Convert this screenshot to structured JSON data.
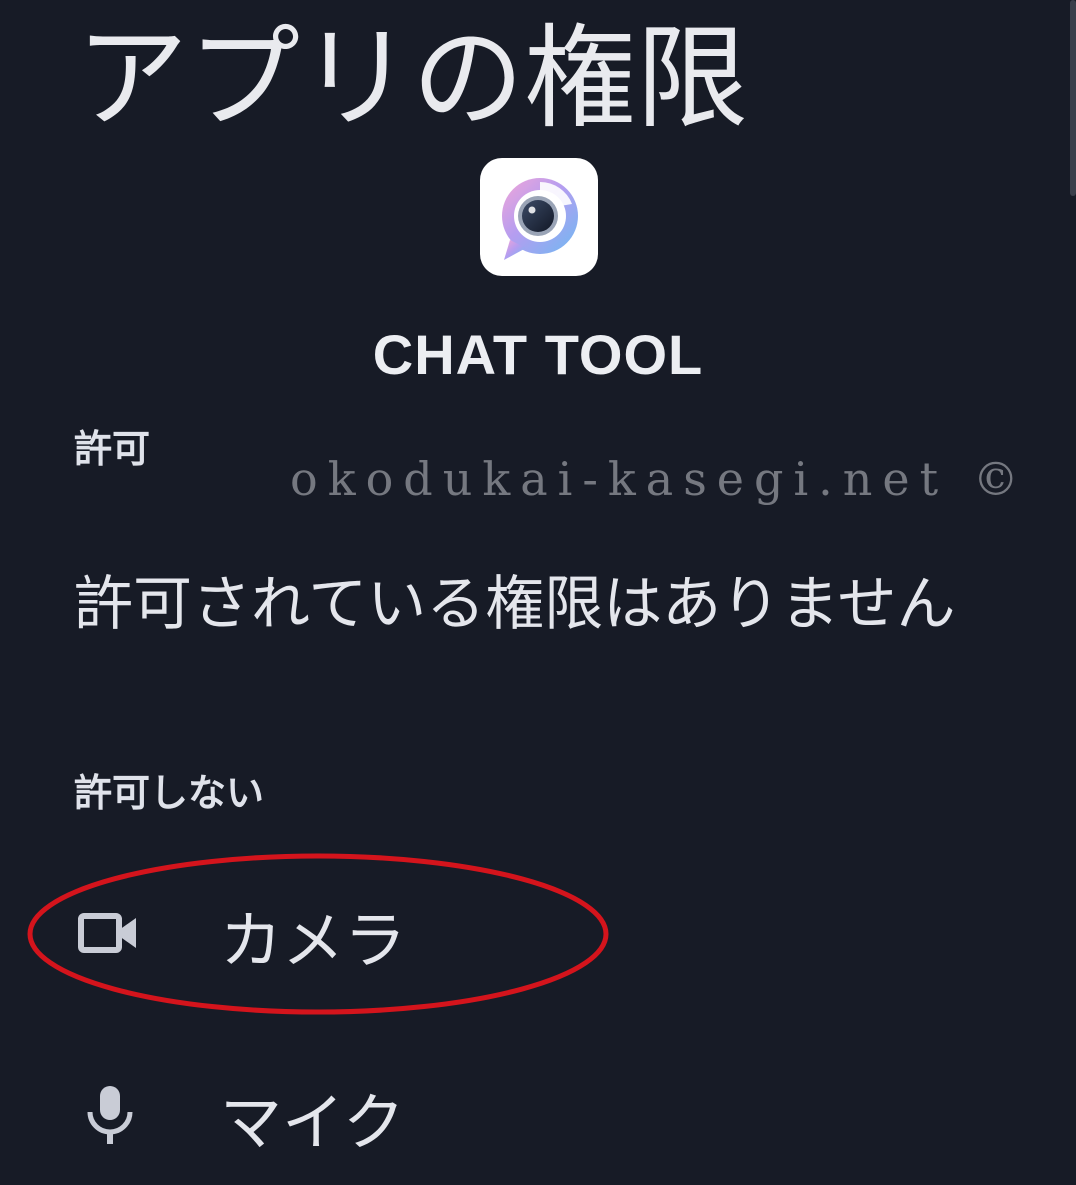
{
  "header": {
    "title": "アプリの権限"
  },
  "app": {
    "name": "CHAT TOOL",
    "icon": "chat-tool-app-icon"
  },
  "sections": {
    "allowed": {
      "heading": "許可",
      "empty_message": "許可されている権限はありません"
    },
    "denied": {
      "heading": "許可しない",
      "items": [
        {
          "label": "カメラ",
          "icon": "videocam-icon"
        },
        {
          "label": "マイク",
          "icon": "mic-icon"
        }
      ]
    }
  },
  "watermark": "okodukai-kasegi.net ©",
  "annotation": {
    "highlight_color": "#d4141c",
    "highlighted_item": "カメラ"
  },
  "colors": {
    "background": "#171b26",
    "text": "#e4e6ec",
    "icon": "#c9ccd6"
  }
}
